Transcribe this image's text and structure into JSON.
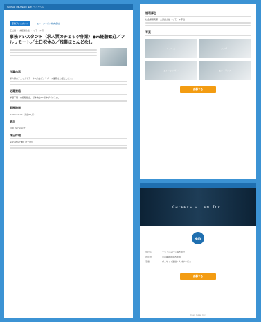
{
  "left": {
    "topbar": "採用情報 / 求人情報 / 事務アシスタント",
    "pill": "事務アシスタント",
    "tagline": "エン・ジャパン株式会社",
    "tags": "正社員 ・ 未経験歓迎 ・ リモート可",
    "title": "事務アシスタント（求人票のチェック作業）◆未経験歓迎／フルリモート／土日祝休み／残業ほとんどなし",
    "sections": [
      {
        "h": "仕事内容",
        "p": "求人票のチェックやデータ入力など、サポート業務をお任せします。"
      },
      {
        "h": "応募資格",
        "p": "学歴不問・未経験歓迎。基本的なPC操作ができる方。"
      },
      {
        "h": "勤務時間",
        "p": "9:30〜18:30（休憩60分）"
      },
      {
        "h": "給与",
        "p": "月給 22万円以上"
      },
      {
        "h": "休日休暇",
        "p": "完全週休2日制（土日祝）"
      }
    ]
  },
  "right_top": {
    "heading1": "福利厚生",
    "p1": "社会保険完備・交通費支給・リモート手当",
    "heading2": "写真",
    "images": [
      "オフィス",
      "メンバー",
      "エン・ジャパン",
      "エントランス"
    ],
    "cta": "応募する"
  },
  "right_bottom": {
    "hero_text": "Careers at en Inc.",
    "logo": "en",
    "info": [
      {
        "k": "会社名",
        "v": "エン・ジャパン株式会社"
      },
      {
        "k": "所在地",
        "v": "東京都新宿区西新宿"
      },
      {
        "k": "事業",
        "v": "求人サイト運営・人材サービス"
      }
    ],
    "cta": "応募する",
    "footer": "© en Japan Inc."
  }
}
